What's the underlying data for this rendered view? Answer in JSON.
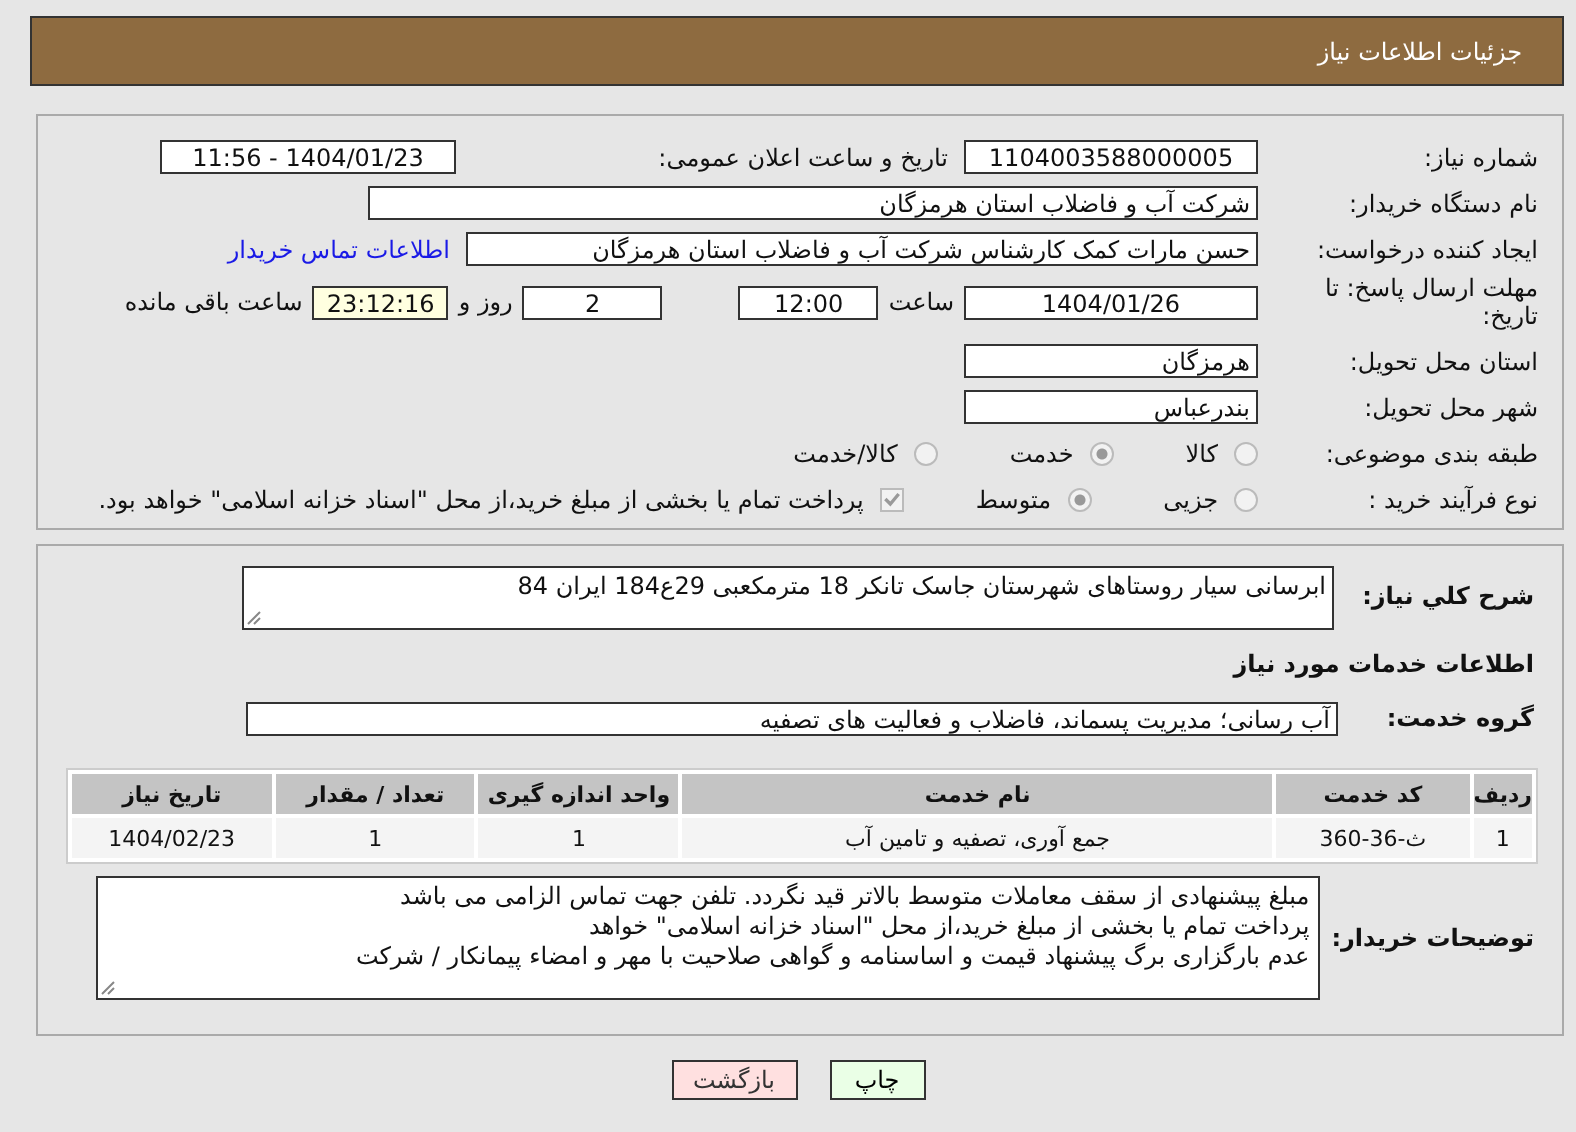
{
  "header": {
    "title": "جزئیات اطلاعات نیاز"
  },
  "need_number": {
    "label": "شماره نیاز:",
    "value": "1104003588000005"
  },
  "announce": {
    "label": "تاریخ و ساعت اعلان عمومی:",
    "value": "1404/01/23 - 11:56"
  },
  "buyer_org": {
    "label": "نام دستگاه خریدار:",
    "value": "شرکت آب و فاضلاب استان هرمزگان"
  },
  "requester": {
    "label": "ایجاد کننده درخواست:",
    "value": "حسن مارات کمک کارشناس شرکت آب و فاضلاب استان هرمزگان",
    "link": "اطلاعات تماس خریدار"
  },
  "deadline": {
    "label": "مهلت ارسال پاسخ: تا تاریخ:",
    "date": "1404/01/26",
    "time_label": "ساعت",
    "time": "12:00",
    "days": "2",
    "days_label": "روز و",
    "remaining": "23:12:16",
    "remaining_label": "ساعت باقی مانده"
  },
  "province": {
    "label": "استان محل تحویل:",
    "value": "هرمزگان"
  },
  "city": {
    "label": "شهر محل تحویل:",
    "value": "بندرعباس"
  },
  "category": {
    "label": "طبقه بندی موضوعی:",
    "options": [
      {
        "label": "کالا",
        "selected": false
      },
      {
        "label": "خدمت",
        "selected": true
      },
      {
        "label": "کالا/خدمت",
        "selected": false
      }
    ]
  },
  "process": {
    "label": "نوع فرآیند خرید :",
    "options": [
      {
        "label": "جزیی",
        "selected": false
      },
      {
        "label": "متوسط",
        "selected": true
      }
    ],
    "payment": {
      "checked": true,
      "text": "پرداخت تمام یا بخشی از مبلغ خرید،از محل \"اسناد خزانه اسلامی\" خواهد بود."
    }
  },
  "description": {
    "label": "شرح کلي نیاز:",
    "value": "ابرسانی سیار روستاهای شهرستان جاسک تانکر 18 مترمکعبی 29ع184 ایران 84"
  },
  "section_title": "اطلاعات خدمات مورد نیاز",
  "service_group": {
    "label": "گروه خدمت:",
    "value": "آب رسانی؛ مدیریت پسماند، فاضلاب و فعالیت های تصفیه"
  },
  "table": {
    "columns": [
      "ردیف",
      "کد خدمت",
      "نام خدمت",
      "واحد اندازه گیری",
      "تعداد / مقدار",
      "تاریخ نیاز"
    ],
    "rows": [
      [
        "1",
        "ث-36-360",
        "جمع آوری، تصفیه و تامین آب",
        "1",
        "1",
        "1404/02/23"
      ]
    ]
  },
  "buyer_notes": {
    "label": "توضیحات خریدار:",
    "lines": [
      "مبلغ پیشنهادی از سقف معاملات متوسط بالاتر قید نگردد. تلفن جهت تماس الزامی می باشد",
      "پرداخت تمام یا بخشی از مبلغ خرید،از محل \"اسناد خزانه اسلامی\" خواهد",
      "عدم بارگزاری برگ پیشنهاد قیمت و اساسنامه و گواهی صلاحیت با مهر و امضاء پیمانکار / شرکت"
    ]
  },
  "buttons": [
    {
      "label": "چاپ",
      "kind": "print"
    },
    {
      "label": "بازگشت",
      "kind": "back"
    }
  ]
}
